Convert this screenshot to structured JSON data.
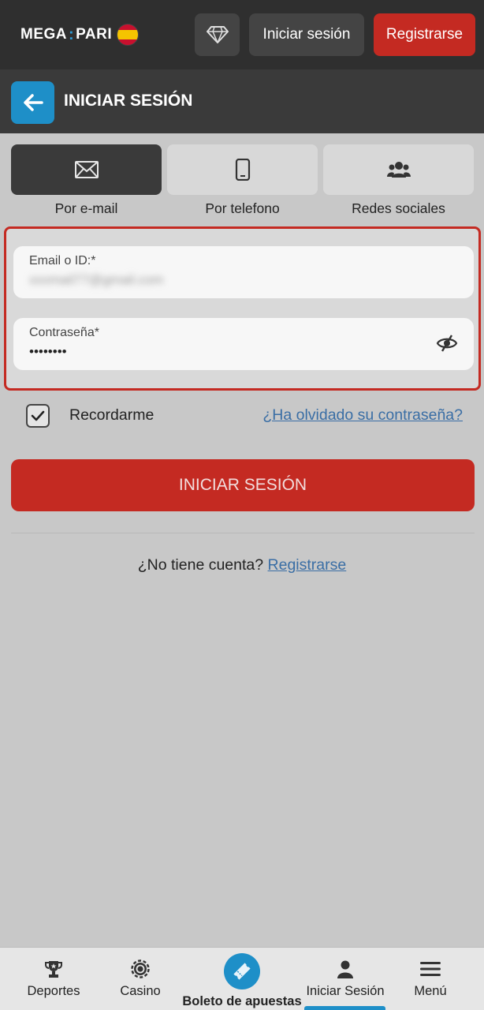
{
  "header": {
    "logo_left": "MEGA",
    "logo_sep": ":",
    "logo_right": "PARI",
    "login_label": "Iniciar sesión",
    "register_label": "Registrarse"
  },
  "title_bar": {
    "title": "INICIAR SESIÓN"
  },
  "methods": [
    {
      "label": "Por e-mail",
      "icon": "envelope-icon",
      "active": true
    },
    {
      "label": "Por telefono",
      "icon": "phone-icon",
      "active": false
    },
    {
      "label": "Redes sociales",
      "icon": "users-icon",
      "active": false
    }
  ],
  "form": {
    "email_label": "Email o ID:*",
    "email_value": "xxxmail77@gmail.com",
    "password_label": "Contraseña*",
    "password_value": "••••••••"
  },
  "remember": {
    "label": "Recordarme",
    "checked": true
  },
  "forgot_link": "¿Ha olvidado su contraseña?",
  "submit_label": "INICIAR SESIÓN",
  "no_account": {
    "text": "¿No tiene cuenta?",
    "link": "Registrarse"
  },
  "bottom_nav": [
    {
      "label": "Deportes",
      "icon": "trophy-icon"
    },
    {
      "label": "Casino",
      "icon": "chip-icon"
    },
    {
      "label": "Boleto de apuestas",
      "icon": "ticket-icon"
    },
    {
      "label": "Iniciar Sesión",
      "icon": "user-icon",
      "active": true
    },
    {
      "label": "Menú",
      "icon": "hamburger-icon"
    }
  ],
  "colors": {
    "accent_blue": "#1e8fc8",
    "brand_red": "#c42a22",
    "header_dark": "#2f2f2f"
  }
}
